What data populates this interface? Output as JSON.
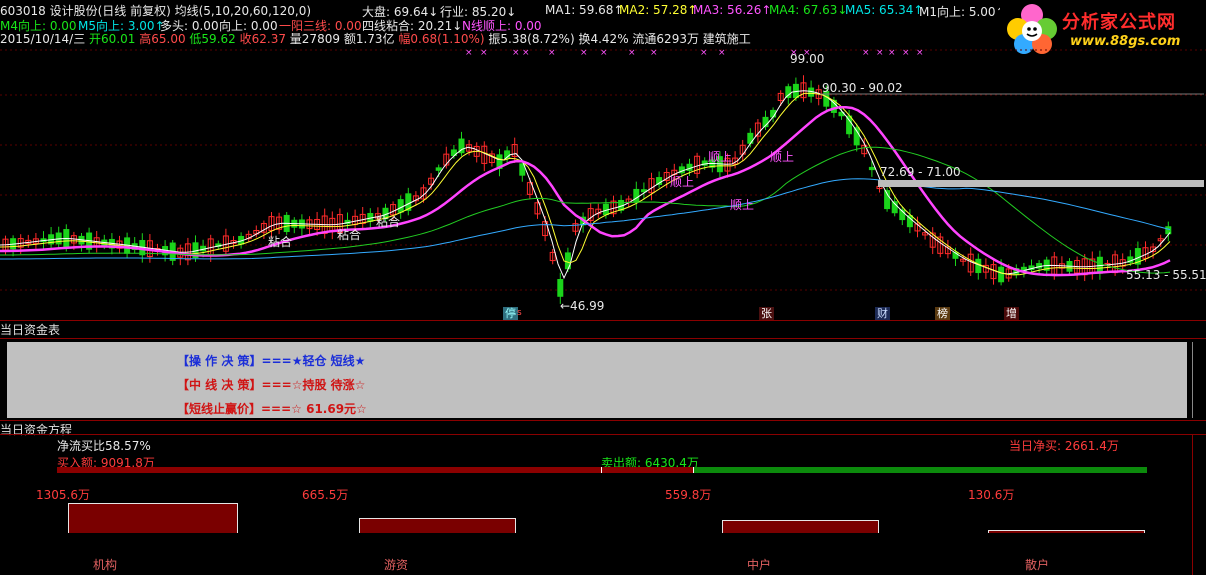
{
  "header": {
    "title": "603018 设计股份(日线 前复权) 均线(5,10,20,60,120,0)",
    "dapan": "大盘: 69.64↓",
    "hangye": "行业: 85.20↓",
    "ma1": "MA1: 59.68↑",
    "ma2": "MA2: 57.28↑",
    "ma3": "MA3: 56.26↑",
    "ma4": "MA4: 67.63↓",
    "ma5": "MA5: 65.34↑",
    "m1": "M1向上: 5.00↑"
  },
  "row2": {
    "m4": "M4向上: 0.00",
    "m5": "M5向上: 3.00↑",
    "duotou": "多头: 0.00",
    "xiangshang": "向上: 0.00",
    "yiyang": "一阳三线: 0.00",
    "sixian": "四线粘合: 20.21↓",
    "nxian": "N线顺上: 0.00"
  },
  "row3": {
    "date": "2015/10/14/三",
    "open": "开60.01",
    "high": "高65.00",
    "low": "低59.62",
    "close": "收62.37",
    "vol": "量27809",
    "amt": "额1.73亿",
    "fu": "幅0.68(1.10%)",
    "zhen": "振5.38(8.72%)",
    "huan": "换4.42%",
    "liutong": "流通6293万",
    "industry": "建筑施工"
  },
  "chart_labels": {
    "high": "99.00",
    "low": "←46.99",
    "range1": "90.30 - 90.02",
    "range2": "72.69 - 71.00",
    "range3": "55.13 - 55.51",
    "nianhe": "粘合",
    "shunshang": "顺上"
  },
  "tags": {
    "ting": "停",
    "zhang": "张",
    "cai": "财",
    "bang": "榜",
    "zeng": "增"
  },
  "logo": {
    "name": "分析家公式网",
    "url": "www.88gs.com"
  },
  "panel1": {
    "title": "当日资金表",
    "line1": "【操 作 决 策】===★轻仓 短线★",
    "line2": "【中 线 决 策】===☆持股 待涨☆",
    "line3": "【短线止赢价】===☆ 61.69元☆"
  },
  "panel2": {
    "title": "当日资金方程",
    "ratio": "净流买比58.57%",
    "buy": "买入额: 9091.8万",
    "sell": "卖出额: 6430.4万",
    "net": "当日净买: 2661.4万",
    "bars": [
      {
        "category": "机构",
        "value": "1305.6万"
      },
      {
        "category": "游资",
        "value": "665.5万"
      },
      {
        "category": "中户",
        "value": "559.8万"
      },
      {
        "category": "散户",
        "value": "130.6万"
      }
    ]
  }
}
